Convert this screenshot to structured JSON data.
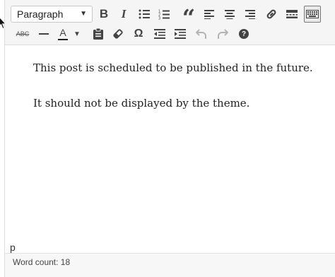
{
  "toolbar": {
    "format_select": {
      "value": "Paragraph",
      "caret_icon": "chevron-down-icon"
    },
    "row1_buttons": [
      {
        "name": "bold-button",
        "icon": "bold-icon",
        "glyph": "B"
      },
      {
        "name": "italic-button",
        "icon": "italic-icon",
        "glyph": "I"
      },
      {
        "name": "bulleted-list-button",
        "icon": "bulleted-list-icon"
      },
      {
        "name": "numbered-list-button",
        "icon": "numbered-list-icon"
      },
      {
        "name": "blockquote-button",
        "icon": "quote-icon",
        "glyph": "“"
      },
      {
        "name": "align-left-button",
        "icon": "align-left-icon"
      },
      {
        "name": "align-center-button",
        "icon": "align-center-icon"
      },
      {
        "name": "align-right-button",
        "icon": "align-right-icon"
      },
      {
        "name": "insert-link-button",
        "icon": "link-icon"
      },
      {
        "name": "read-more-button",
        "icon": "read-more-icon"
      },
      {
        "name": "toolbar-toggle-button",
        "icon": "keyboard-icon",
        "active": true
      }
    ],
    "row2_buttons": [
      {
        "name": "strikethrough-button",
        "icon": "strikethrough-icon",
        "glyph": "ABC"
      },
      {
        "name": "horizontal-line-button",
        "icon": "horizontal-line-icon"
      },
      {
        "name": "text-color-button",
        "icon": "text-color-icon",
        "glyph": "A"
      },
      {
        "name": "paste-as-text-button",
        "icon": "clipboard-icon"
      },
      {
        "name": "clear-formatting-button",
        "icon": "eraser-icon"
      },
      {
        "name": "special-character-button",
        "icon": "omega-icon",
        "glyph": "Ω"
      },
      {
        "name": "decrease-indent-button",
        "icon": "outdent-icon"
      },
      {
        "name": "increase-indent-button",
        "icon": "indent-icon"
      },
      {
        "name": "undo-button",
        "icon": "undo-icon",
        "disabled": true
      },
      {
        "name": "redo-button",
        "icon": "redo-icon",
        "disabled": true
      },
      {
        "name": "keyboard-shortcuts-button",
        "icon": "help-icon",
        "glyph": "?"
      }
    ]
  },
  "content": {
    "paragraphs": [
      "This post is scheduled to be published in the future.",
      "It should not be displayed by the theme."
    ]
  },
  "path": "p",
  "status": {
    "word_count": "Word count: 18"
  },
  "colors": {
    "toolbar_bg": "#f5f5f5",
    "icon": "#444444",
    "disabled_icon": "#b4b4b4",
    "border": "#dddddd"
  }
}
